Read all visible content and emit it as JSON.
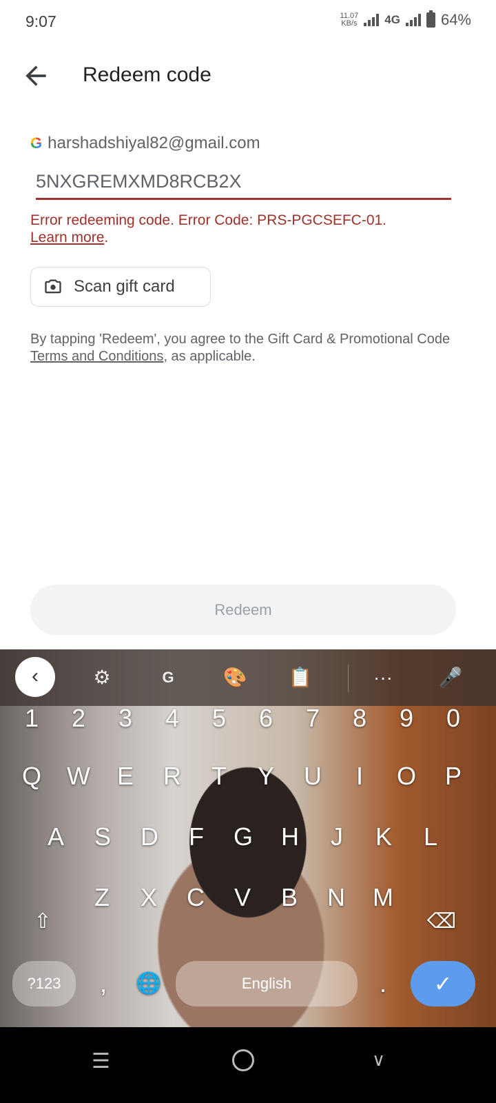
{
  "status": {
    "time": "9:07",
    "speed_value": "11.07",
    "speed_unit": "KB/s",
    "network": "4G",
    "battery": "64%"
  },
  "header": {
    "title": "Redeem code",
    "back_icon": "arrow-left-icon"
  },
  "account": {
    "email": "harshadshiyal82@gmail.com",
    "icon": "google-g-icon"
  },
  "code_input": {
    "value": "5NXGREMXMD8RCB2X"
  },
  "error": {
    "message": "Error redeeming code. Error Code: PRS-PGCSEFC-01.",
    "link": "Learn more",
    "suffix": ".",
    "color": "#a0302a"
  },
  "scan": {
    "label": "Scan gift card",
    "icon": "camera-icon"
  },
  "terms": {
    "prefix": "By tapping 'Redeem', you agree to the Gift Card & Promotional Code ",
    "link": "Terms and Conditions",
    "suffix": ", as applicable."
  },
  "redeem": {
    "label": "Redeem"
  },
  "keyboard": {
    "numbers": [
      "1",
      "2",
      "3",
      "4",
      "5",
      "6",
      "7",
      "8",
      "9",
      "0"
    ],
    "row1": [
      "Q",
      "W",
      "E",
      "R",
      "T",
      "Y",
      "U",
      "I",
      "O",
      "P"
    ],
    "row2": [
      "A",
      "S",
      "D",
      "F",
      "G",
      "H",
      "J",
      "K",
      "L"
    ],
    "row3": [
      "Z",
      "X",
      "C",
      "V",
      "B",
      "N",
      "M"
    ],
    "symbols_label": "?123",
    "comma": ",",
    "period": ".",
    "space_label": "English",
    "accent": "#5d9cec"
  }
}
